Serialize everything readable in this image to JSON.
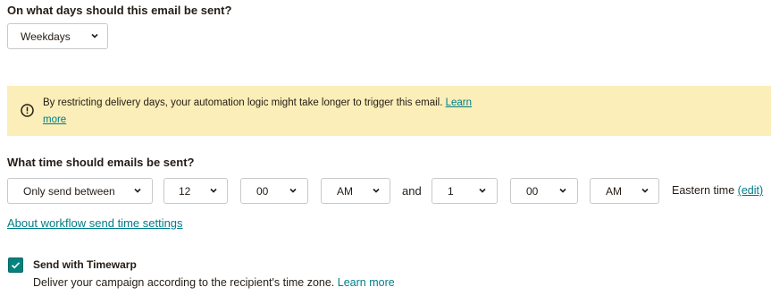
{
  "days_section": {
    "title": "On what days should this email be sent?",
    "select_value": "Weekdays"
  },
  "banner": {
    "text": "By restricting delivery days, your automation logic might take longer to trigger this email.",
    "link": "Learn more"
  },
  "time_section": {
    "title": "What time should emails be sent?",
    "mode_value": "Only send between",
    "start_hour": "12",
    "start_minute": "00",
    "start_ampm": "AM",
    "and_label": "and",
    "end_hour": "1",
    "end_minute": "00",
    "end_ampm": "AM",
    "timezone_label": "Eastern time",
    "edit_link": "(edit)",
    "about_link": "About workflow send time settings"
  },
  "timewarp": {
    "checked": true,
    "label": "Send with Timewarp",
    "description": "Deliver your campaign according to the recipient's time zone.",
    "learn_more": "Learn more"
  },
  "colors": {
    "banner_bg": "#fbeeb8",
    "link": "#007c89",
    "checkbox": "#00837b"
  },
  "icons": [
    "chevron-down-icon",
    "warning-circle-icon",
    "checkmark-icon"
  ]
}
